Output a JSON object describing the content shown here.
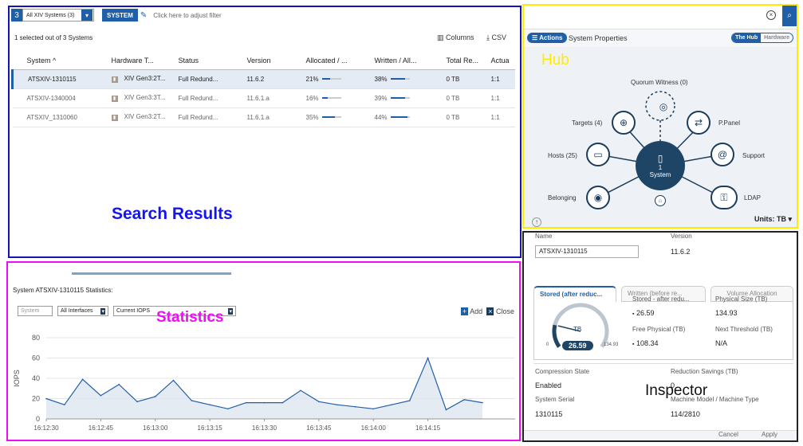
{
  "search": {
    "count": "3",
    "system_filter": "All XIV Systems (3)",
    "system_button": "SYSTEM",
    "filter_hint": "Click here to adjust filter",
    "selected_text": "1 selected out of 3 Systems",
    "columns_label": "Columns",
    "csv_label": "CSV",
    "headers": [
      "System ^",
      "Hardware T...",
      "Status",
      "Version",
      "Allocated / ...",
      "Written / All...",
      "Total Re...",
      "Actua"
    ],
    "rows": [
      {
        "system": "ATSXIV-1310115",
        "hw": "XIV Gen3:2T...",
        "status": "Full Redund...",
        "version": "11.6.2",
        "allocated": "21%",
        "alloc_pct": 21,
        "written": "38%",
        "written_pct": 38,
        "total": "0 TB",
        "actual": "1:1"
      },
      {
        "system": "ATSXIV-1340004",
        "hw": "XIV Gen3:3T...",
        "status": "Full Redund...",
        "version": "11.6.1.a",
        "allocated": "16%",
        "alloc_pct": 16,
        "written": "39%",
        "written_pct": 39,
        "total": "0 TB",
        "actual": "1:1"
      },
      {
        "system": "ATSXIV_1310060",
        "hw": "XIV Gen3:2T...",
        "status": "Full Redund...",
        "version": "11.6.1.a",
        "allocated": "35%",
        "alloc_pct": 35,
        "written": "44%",
        "written_pct": 44,
        "total": "0 TB",
        "actual": "1:1"
      }
    ],
    "region_label": "Search Results"
  },
  "hub": {
    "actions_label": "Actions",
    "system_properties": "System Properties",
    "toggle_hub": "The Hub",
    "toggle_hardware": "Hardware",
    "region_label": "Hub",
    "nodes": {
      "quorum": "Quorum Witness (0)",
      "targets": "Targets (4)",
      "ppanel": "P.Panel",
      "hosts": "Hosts (25)",
      "support": "Support",
      "belonging": "Belonging",
      "ldap": "LDAP"
    },
    "center_count": "1",
    "center_label": "System",
    "units": "Units: TB"
  },
  "stats": {
    "title": "System ATSXIV-1310115 Statistics:",
    "system_select": "System",
    "interfaces_select": "All Interfaces",
    "metric_select": "Current IOPS",
    "add_label": "Add",
    "close_label": "Close",
    "region_label": "Statistics"
  },
  "chart_data": {
    "type": "area",
    "title": "",
    "xlabel": "",
    "ylabel": "IOPS",
    "ylim": [
      0,
      80
    ],
    "yticks": [
      0,
      20,
      40,
      60,
      80
    ],
    "xticks": [
      "16:12:30",
      "16:12:45",
      "16:13:00",
      "16:13:15",
      "16:13:30",
      "16:13:45",
      "16:14:00",
      "16:14:15"
    ],
    "x": [
      "16:12:30",
      "16:12:37",
      "16:12:45",
      "16:12:52",
      "16:13:00",
      "16:13:07",
      "16:13:15",
      "16:13:22",
      "16:13:30",
      "16:13:37",
      "16:13:45",
      "16:13:52",
      "16:14:00",
      "16:14:07",
      "16:14:15",
      "16:14:22",
      "16:14:30"
    ],
    "series": [
      {
        "values": [
          20,
          14,
          39,
          23,
          34,
          17,
          22,
          38,
          18,
          14,
          10,
          16,
          16,
          16,
          28,
          17,
          14,
          12,
          10,
          14,
          18,
          60,
          9,
          19,
          16
        ]
      }
    ],
    "points_per_tick": 3
  },
  "inspector": {
    "name_label": "Name",
    "name_value": "ATSXIV-1310115",
    "version_label": "Version",
    "version_value": "11.6.2",
    "tabs": [
      "Stored (after reduc...",
      "Written (before re...",
      "Volume Allocation"
    ],
    "gauge_unit": "TB",
    "gauge_value": "26.59",
    "gauge_min": "0",
    "gauge_max": "134.93",
    "gauge_fraction": 0.197,
    "stored_label": "Stored - after redu...",
    "stored_value": "26.59",
    "physical_label": "Physical Size (TB)",
    "physical_value": "134.93",
    "free_label": "Free Physical (TB)",
    "free_value": "108.34",
    "next_label": "Next Threshold (TB)",
    "next_value": "N/A",
    "compression_label": "Compression State",
    "compression_value": "Enabled",
    "reduction_label": "Reduction Savings (TB)",
    "reduction_value": "0",
    "serial_label": "System Serial",
    "serial_value": "1310115",
    "model_label": "Machine Model / Machine Type",
    "model_value": "114/2810",
    "cancel_label": "Cancel",
    "apply_label": "Apply",
    "region_label": "Inspector"
  },
  "colors": {
    "accent": "#1f5fa8",
    "search_border": "#1414b4",
    "hub_border": "#ffeb00",
    "stats_border": "#f00cf5",
    "inspector_border": "#222222",
    "hub_center": "#1e4466"
  }
}
